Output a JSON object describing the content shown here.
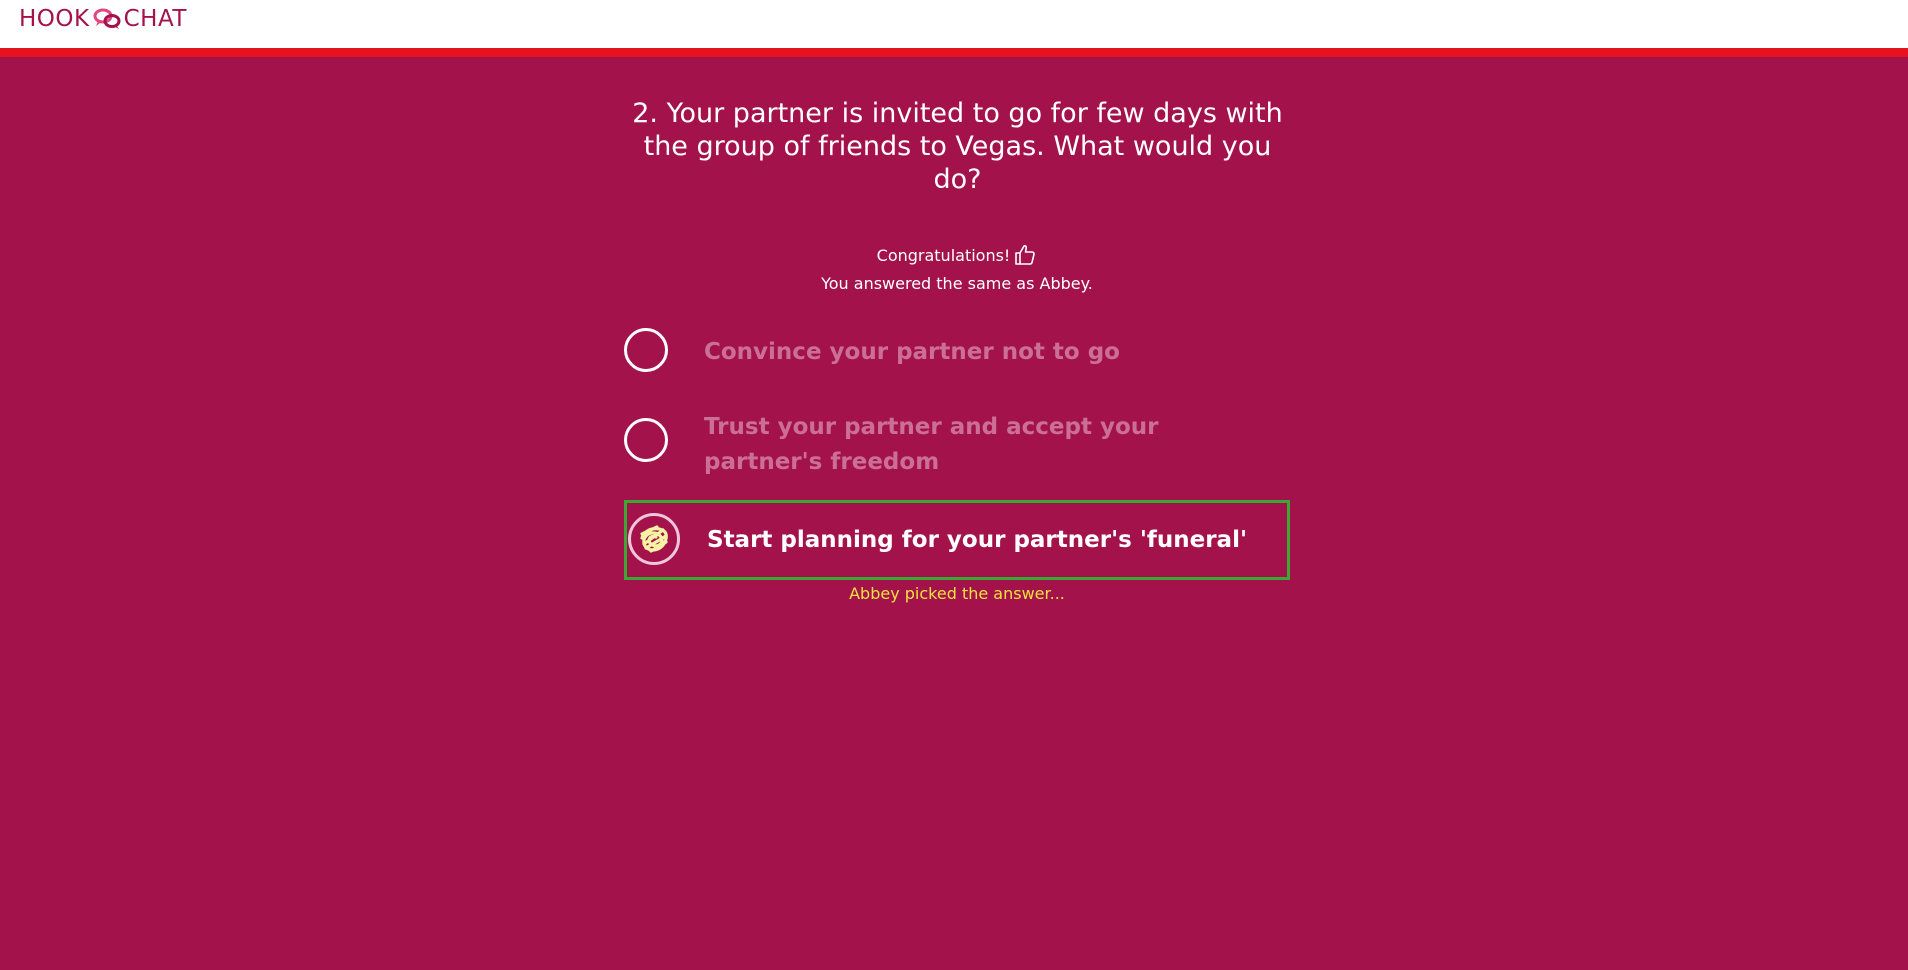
{
  "header": {
    "logo_left": "HOOK",
    "logo_right": "CHAT",
    "logo_icon": "chat-bubbles-icon"
  },
  "question": {
    "text": "2. Your partner is invited to go for few days with the group of friends to Vegas. What would you do?"
  },
  "result": {
    "congrats": "Congratulations!",
    "congrats_icon": "thumbs-up-icon",
    "message": "You answered the same as Abbey."
  },
  "options": [
    {
      "label": "Convince your partner not to go",
      "selected": false
    },
    {
      "label": "Trust your partner and accept your partner's freedom",
      "selected": false
    },
    {
      "label": "Start planning for your partner's 'funeral'",
      "selected": true
    }
  ],
  "picked_note": "Abbey picked the answer...",
  "colors": {
    "background": "#a4124c",
    "accent_bar": "#e6121f",
    "correct_border": "#3aa832",
    "picked_text": "#f0e23a",
    "dimmed_text": "#cc6f98"
  }
}
